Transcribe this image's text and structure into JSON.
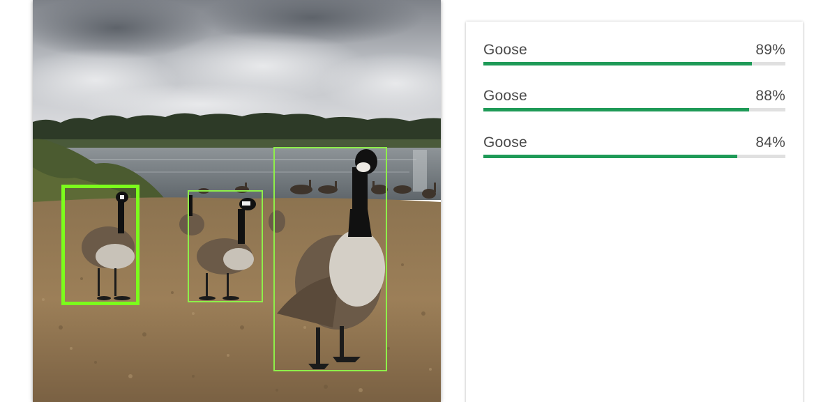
{
  "colors": {
    "detection_box": "#7cfc1c",
    "confidence_bar": "#1e9a57",
    "confidence_track": "#e0e0e0",
    "label_text": "#4a4a4a"
  },
  "photo": {
    "subject": "Canada geese standing on a gravel lakeshore under a cloudy sky"
  },
  "detections": [
    {
      "label": "Goose",
      "confidence": 0.89,
      "confidence_text": "89%"
    },
    {
      "label": "Goose",
      "confidence": 0.88,
      "confidence_text": "88%"
    },
    {
      "label": "Goose",
      "confidence": 0.84,
      "confidence_text": "84%"
    }
  ]
}
